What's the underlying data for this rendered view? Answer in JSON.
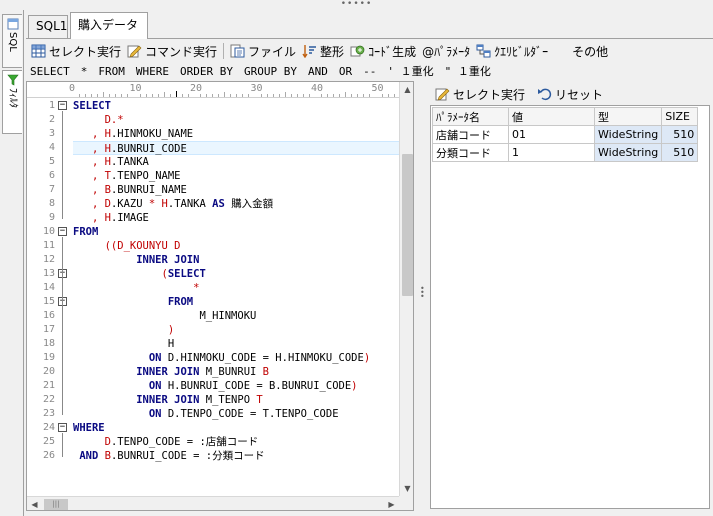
{
  "vertical_tabs": [
    {
      "label": "SQL",
      "icon": "sql-tab-icon"
    },
    {
      "label": "ﾌｨﾙﾀ",
      "icon": "filter-tab-icon"
    }
  ],
  "tabs": [
    {
      "label": "SQL1"
    },
    {
      "label": "購入データ",
      "active": true
    }
  ],
  "toolbar": {
    "select_exec": "セレクト実行",
    "command_exec": "コマンド実行",
    "file": "ファイル",
    "format": "整形",
    "code_gen": "ｺｰﾄﾞ生成",
    "params": "@ﾊﾟﾗﾒｰﾀ",
    "query_builder": "ｸｴﾘﾋﾞﾙﾀﾞｰ",
    "other": "その他"
  },
  "keywords": [
    "SELECT",
    "*",
    "FROM",
    "WHERE",
    "ORDER BY",
    "GROUP BY",
    "AND",
    "OR",
    "--",
    "' １重化",
    "\" １重化"
  ],
  "ruler": {
    "labels": [
      "0",
      "10",
      "20",
      "30",
      "40",
      "50"
    ]
  },
  "editor": {
    "line_numbers": [
      "1",
      "2",
      "3",
      "4",
      "5",
      "6",
      "7",
      "8",
      "9",
      "10",
      "11",
      "12",
      "13",
      "14",
      "15",
      "16",
      "17",
      "18",
      "19",
      "20",
      "21",
      "22",
      "23",
      "24",
      "25",
      "26"
    ],
    "fold_marks": [
      "−",
      "−",
      "−",
      "−",
      "−",
      "−",
      "−"
    ],
    "hscroll_grip": "|||",
    "lines": [
      {
        "indent": "",
        "segments": [
          {
            "t": "SELECT",
            "c": "k"
          }
        ]
      },
      {
        "indent": "     ",
        "segments": [
          {
            "t": "D.*",
            "c": "r"
          }
        ]
      },
      {
        "indent": "   ",
        "segments": [
          {
            "t": ", ",
            "c": "r"
          },
          {
            "t": "H",
            "c": "r"
          },
          {
            "t": ".HINMOKU_NAME",
            "c": "n"
          }
        ]
      },
      {
        "indent": "   ",
        "segments": [
          {
            "t": ", ",
            "c": "r"
          },
          {
            "t": "H",
            "c": "r"
          },
          {
            "t": ".BUNRUI_CODE",
            "c": "n"
          }
        ]
      },
      {
        "indent": "   ",
        "segments": [
          {
            "t": ", ",
            "c": "r"
          },
          {
            "t": "H",
            "c": "r"
          },
          {
            "t": ".TANKA",
            "c": "n"
          }
        ]
      },
      {
        "indent": "   ",
        "segments": [
          {
            "t": ", ",
            "c": "r"
          },
          {
            "t": "T",
            "c": "r"
          },
          {
            "t": ".TENPO_NAME",
            "c": "n"
          }
        ]
      },
      {
        "indent": "   ",
        "segments": [
          {
            "t": ", ",
            "c": "r"
          },
          {
            "t": "B",
            "c": "r"
          },
          {
            "t": ".BUNRUI_NAME",
            "c": "n"
          }
        ]
      },
      {
        "indent": "   ",
        "segments": [
          {
            "t": ", ",
            "c": "r"
          },
          {
            "t": "D",
            "c": "r"
          },
          {
            "t": ".KAZU ",
            "c": "n"
          },
          {
            "t": "* ",
            "c": "r"
          },
          {
            "t": "H",
            "c": "r"
          },
          {
            "t": ".TANKA ",
            "c": "n"
          },
          {
            "t": "AS",
            "c": "k"
          },
          {
            "t": " 購入金額",
            "c": "n"
          }
        ]
      },
      {
        "indent": "   ",
        "segments": [
          {
            "t": ", ",
            "c": "r"
          },
          {
            "t": "H",
            "c": "r"
          },
          {
            "t": ".IMAGE",
            "c": "n"
          }
        ]
      },
      {
        "indent": "",
        "segments": [
          {
            "t": "FROM",
            "c": "k"
          }
        ]
      },
      {
        "indent": "     ",
        "segments": [
          {
            "t": "((D_KOUNYU ",
            "c": "r"
          },
          {
            "t": "D",
            "c": "r"
          }
        ]
      },
      {
        "indent": "          ",
        "segments": [
          {
            "t": "INNER JOIN",
            "c": "k"
          }
        ]
      },
      {
        "indent": "              ",
        "segments": [
          {
            "t": "(",
            "c": "r"
          },
          {
            "t": "SELECT",
            "c": "k"
          }
        ]
      },
      {
        "indent": "                   ",
        "segments": [
          {
            "t": "*",
            "c": "r"
          }
        ]
      },
      {
        "indent": "               ",
        "segments": [
          {
            "t": "FROM",
            "c": "k"
          }
        ]
      },
      {
        "indent": "                    ",
        "segments": [
          {
            "t": "M_HINMOKU",
            "c": "n"
          }
        ]
      },
      {
        "indent": "               ",
        "segments": [
          {
            "t": ")",
            "c": "r"
          }
        ]
      },
      {
        "indent": "               ",
        "segments": [
          {
            "t": "H",
            "c": "n"
          }
        ]
      },
      {
        "indent": "            ",
        "segments": [
          {
            "t": "ON",
            "c": "k"
          },
          {
            "t": " D.HINMOKU_CODE = H.HINMOKU_CODE",
            "c": "n"
          },
          {
            "t": ")",
            "c": "r"
          }
        ]
      },
      {
        "indent": "          ",
        "segments": [
          {
            "t": "INNER JOIN",
            "c": "k"
          },
          {
            "t": " M_BUNRUI ",
            "c": "n"
          },
          {
            "t": "B",
            "c": "r"
          }
        ]
      },
      {
        "indent": "            ",
        "segments": [
          {
            "t": "ON",
            "c": "k"
          },
          {
            "t": " H.BUNRUI_CODE = B.BUNRUI_CODE",
            "c": "n"
          },
          {
            "t": ")",
            "c": "r"
          }
        ]
      },
      {
        "indent": "          ",
        "segments": [
          {
            "t": "INNER JOIN",
            "c": "k"
          },
          {
            "t": " M_TENPO ",
            "c": "n"
          },
          {
            "t": "T",
            "c": "r"
          }
        ]
      },
      {
        "indent": "            ",
        "segments": [
          {
            "t": "ON",
            "c": "k"
          },
          {
            "t": " D.TENPO_CODE = T.TENPO_CODE",
            "c": "n"
          }
        ]
      },
      {
        "indent": "",
        "segments": [
          {
            "t": "WHERE",
            "c": "k"
          }
        ]
      },
      {
        "indent": "     ",
        "segments": [
          {
            "t": "D",
            "c": "r"
          },
          {
            "t": ".TENPO_CODE = :店舗コード",
            "c": "n"
          }
        ]
      },
      {
        "indent": " ",
        "segments": [
          {
            "t": "AND",
            "c": "k"
          },
          {
            "t": " ",
            "c": "n"
          },
          {
            "t": "B",
            "c": "r"
          },
          {
            "t": ".BUNRUI_CODE = :分類コード",
            "c": "n"
          }
        ]
      }
    ]
  },
  "right_panel": {
    "select_exec": "セレクト実行",
    "reset": "リセット",
    "columns": [
      "ﾊﾟﾗﾒｰﾀ名",
      "値",
      "型",
      "SIZE"
    ],
    "rows": [
      [
        "店舗コード",
        "01",
        "WideString",
        "510"
      ],
      [
        "分類コード",
        "1",
        "WideString",
        "510"
      ]
    ]
  },
  "colors": {
    "keyword": "#0a0a82",
    "alias": "#c00000",
    "current_line": "#eaf6ff"
  }
}
